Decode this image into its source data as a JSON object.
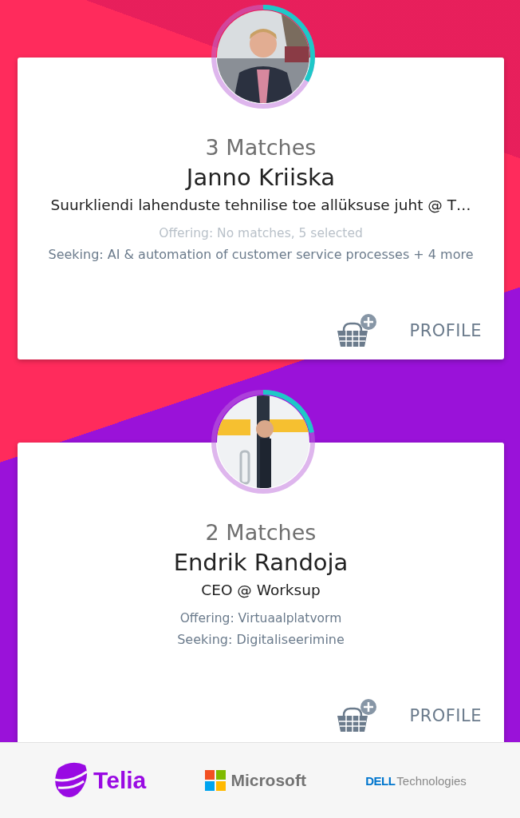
{
  "cards": [
    {
      "matches": "3 Matches",
      "name": "Janno Kriiska",
      "title": "Suurkliendi lahenduste tehnilise toe allüksuse juht @ T…",
      "offering": {
        "text": "Offering: No matches, 5 selected",
        "dimmed": true
      },
      "seeking": "Seeking: AI & automation of customer service processes + 4 more",
      "avatar": {
        "kind": "picture",
        "level": 0.33
      },
      "profile_button": "PROFILE"
    },
    {
      "matches": "2 Matches",
      "name": "Endrik Randoja",
      "title": "CEO @ Worksup",
      "offering": {
        "text": "Offering: Virtuaalplatvorm",
        "dimmed": false
      },
      "seeking": "Seeking: Digitaliseerimine",
      "avatar": {
        "kind": "picture",
        "level": 0.22
      },
      "profile_button": "PROFILE"
    }
  ],
  "sponsors": {
    "telia": "Telia",
    "microsoft": "Microsoft",
    "dell": "DELL",
    "dell_suffix": "Technologies"
  }
}
